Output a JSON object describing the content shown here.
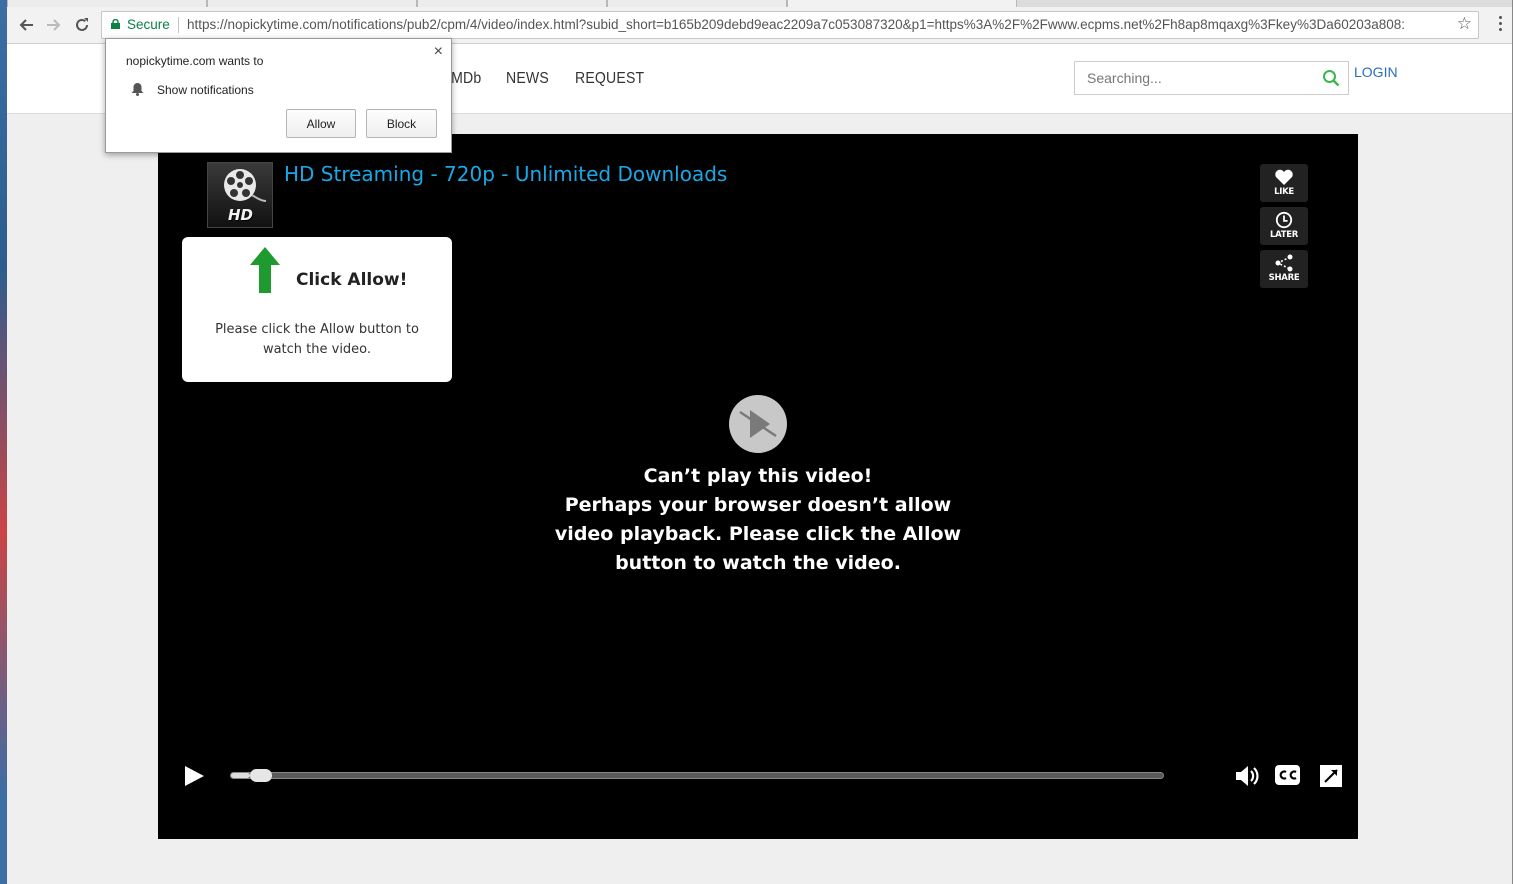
{
  "browser": {
    "secure_label": "Secure",
    "url": "https://nopickytime.com/notifications/pub2/cpm/4/video/index.html?subid_short=b165b209debd9eac2209a7c053087320&p1=https%3A%2F%2Fwww.ecpms.net%2Fh8ap8mqaxg%3Fkey%3Da60203a808:",
    "back_icon": "back-arrow-icon",
    "forward_icon": "forward-arrow-icon",
    "reload_icon": "reload-icon",
    "star_icon": "bookmark-star-icon"
  },
  "permission_prompt": {
    "origin_text": "nopickytime.com wants to",
    "request_text": "Show notifications",
    "allow_label": "Allow",
    "block_label": "Block",
    "close_glyph": "×"
  },
  "site": {
    "nav": [
      "IMDb",
      "NEWS",
      "REQUEST"
    ],
    "search_placeholder": "Searching...",
    "login_label": "LOGIN",
    "accent_color": "#2a6ebb"
  },
  "video": {
    "title": "HD Streaming - 720p - Unlimited Downloads",
    "thumb_label": "HD",
    "side_buttons": [
      "LIKE",
      "LATER",
      "SHARE"
    ],
    "allow_card": {
      "heading": "Click Allow!",
      "body": "Please click the Allow button to watch the video."
    },
    "error_heading": "Can’t play this video!",
    "error_body": "Perhaps your browser doesn’t allow video playback. Please click the Allow button to watch the video.",
    "progress": 0.02,
    "title_color": "#1aa7e8"
  }
}
